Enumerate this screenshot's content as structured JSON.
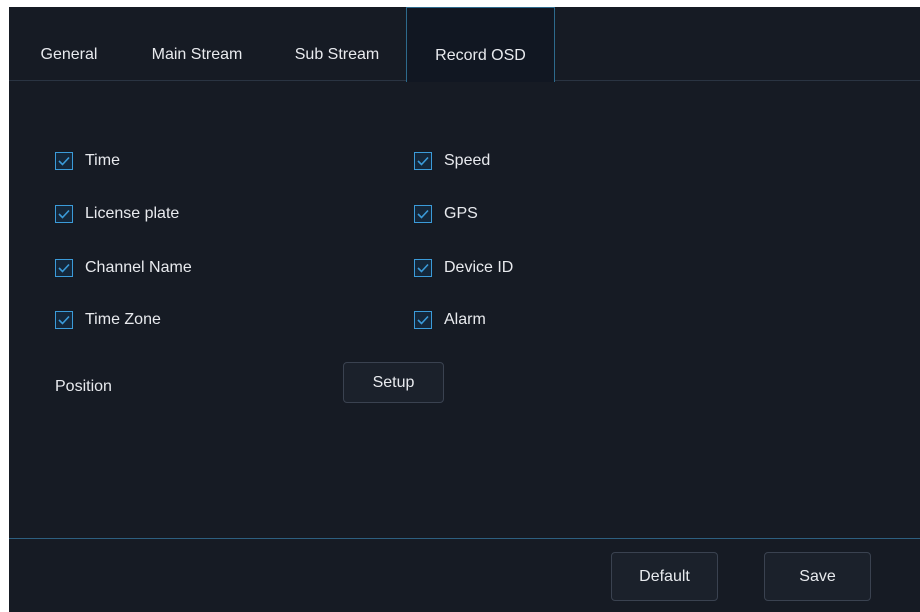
{
  "tabs": [
    {
      "label": "General",
      "active": false
    },
    {
      "label": "Main Stream",
      "active": false
    },
    {
      "label": "Sub Stream",
      "active": false
    },
    {
      "label": "Record OSD",
      "active": true
    }
  ],
  "osd_options": {
    "left": [
      {
        "label": "Time",
        "checked": true
      },
      {
        "label": "License plate",
        "checked": true
      },
      {
        "label": "Channel Name",
        "checked": true
      },
      {
        "label": "Time Zone",
        "checked": true
      }
    ],
    "right": [
      {
        "label": "Speed",
        "checked": true
      },
      {
        "label": "GPS",
        "checked": true
      },
      {
        "label": "Device ID",
        "checked": true
      },
      {
        "label": "Alarm",
        "checked": true
      }
    ]
  },
  "position": {
    "label": "Position",
    "button_label": "Setup"
  },
  "footer": {
    "default_label": "Default",
    "save_label": "Save"
  },
  "colors": {
    "background": "#161b24",
    "accent": "#3b9bd9",
    "text": "#e8eaee"
  },
  "icons": {
    "checkbox": "checkmark-icon"
  }
}
